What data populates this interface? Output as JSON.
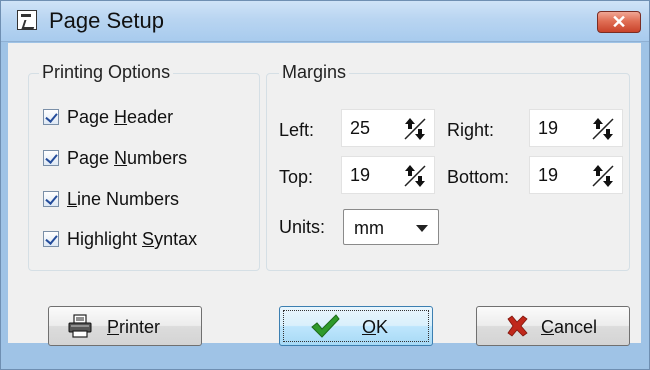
{
  "window": {
    "title": "Page Setup",
    "close_glyph": "✕"
  },
  "printing_options": {
    "title": "Printing Options",
    "items": [
      {
        "pre": "Page ",
        "key": "H",
        "post": "eader",
        "checked": true
      },
      {
        "pre": "Page ",
        "key": "N",
        "post": "umbers",
        "checked": true
      },
      {
        "pre": "",
        "key": "L",
        "post": "ine Numbers",
        "checked": true
      },
      {
        "pre": "Highlight ",
        "key": "S",
        "post": "yntax",
        "checked": true
      }
    ]
  },
  "margins": {
    "title": "Margins",
    "left_label": "Left:",
    "left_value": "25",
    "right_label": "Right:",
    "right_value": "19",
    "top_label": "Top:",
    "top_value": "19",
    "bottom_label": "Bottom:",
    "bottom_value": "19",
    "units_label": "Units:",
    "units_value": "mm"
  },
  "buttons": {
    "printer": {
      "key": "P",
      "rest": "rinter",
      "icon": "printer-icon"
    },
    "ok": {
      "key": "O",
      "rest": "K",
      "icon": "checkmark-icon"
    },
    "cancel": {
      "key": "C",
      "rest": "ancel",
      "icon": "x-mark-icon"
    }
  },
  "colors": {
    "title_bar": "#b9d5f1",
    "close_button": "#d9553c",
    "ok_check": "#2f9a2b",
    "cancel_x": "#c0281b",
    "checkbox_mark": "#254d9c"
  }
}
